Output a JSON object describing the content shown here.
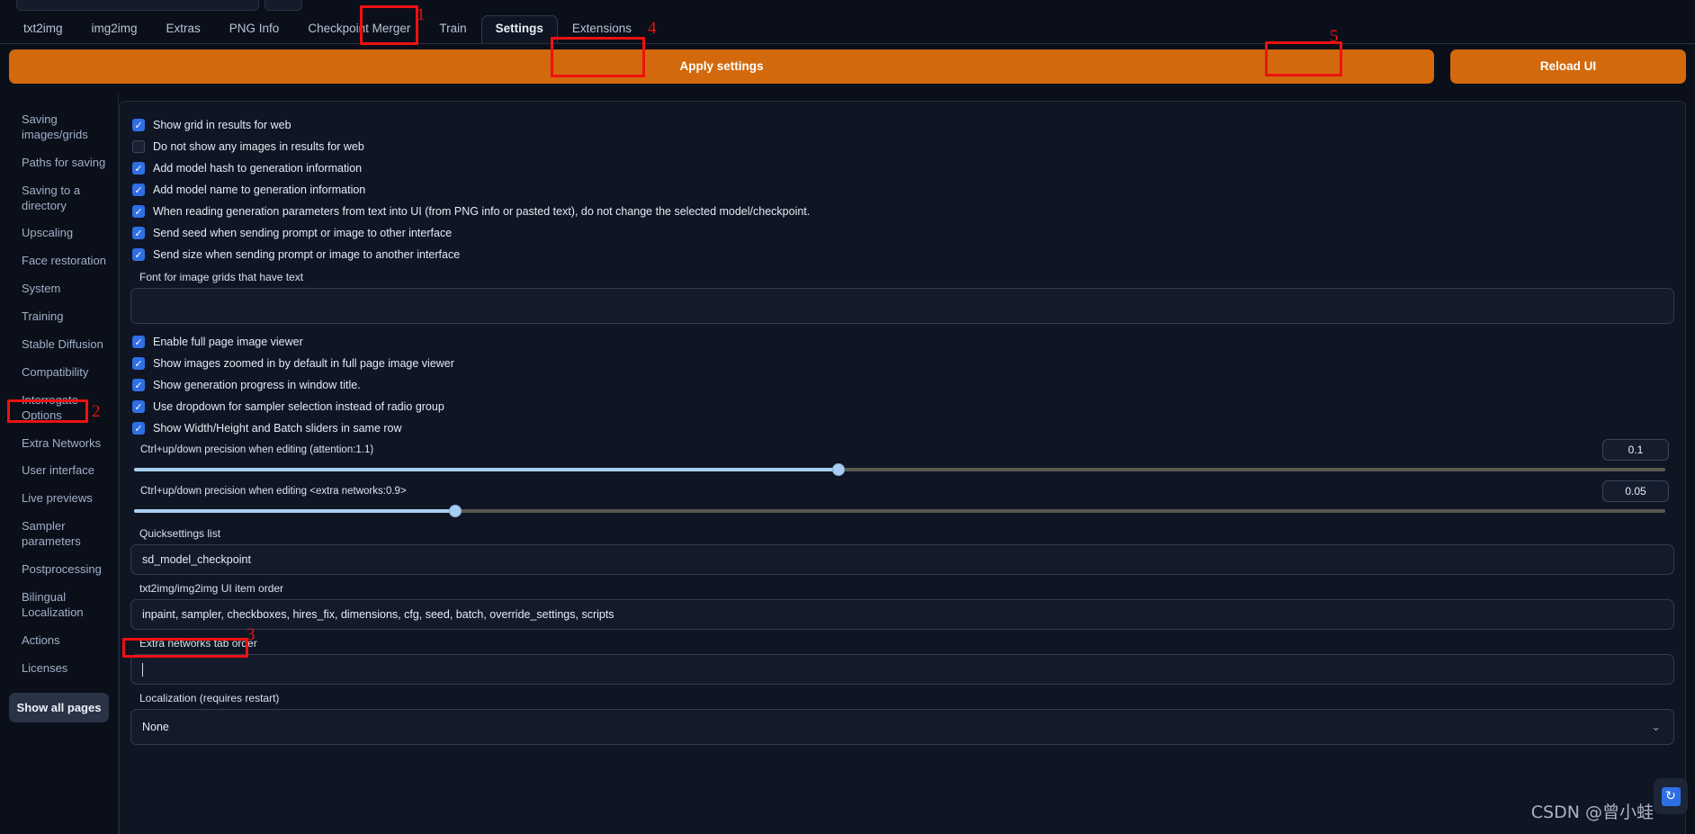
{
  "tabs": [
    {
      "label": "txt2img",
      "active": false
    },
    {
      "label": "img2img",
      "active": false
    },
    {
      "label": "Extras",
      "active": false
    },
    {
      "label": "PNG Info",
      "active": false
    },
    {
      "label": "Checkpoint Merger",
      "active": false
    },
    {
      "label": "Train",
      "active": false
    },
    {
      "label": "Settings",
      "active": true
    },
    {
      "label": "Extensions",
      "active": false
    }
  ],
  "buttons": {
    "apply": "Apply settings",
    "reload": "Reload UI"
  },
  "sidebar": {
    "items": [
      {
        "label": "Saving images/grids",
        "selected": false
      },
      {
        "label": "Paths for saving",
        "selected": false
      },
      {
        "label": "Saving to a directory",
        "selected": false
      },
      {
        "label": "Upscaling",
        "selected": false
      },
      {
        "label": "Face restoration",
        "selected": false
      },
      {
        "label": "System",
        "selected": false
      },
      {
        "label": "Training",
        "selected": false
      },
      {
        "label": "Stable Diffusion",
        "selected": false
      },
      {
        "label": "Compatibility",
        "selected": false
      },
      {
        "label": "Interrogate Options",
        "selected": false
      },
      {
        "label": "Extra Networks",
        "selected": false
      },
      {
        "label": "User interface",
        "selected": true
      },
      {
        "label": "Live previews",
        "selected": false
      },
      {
        "label": "Sampler parameters",
        "selected": false
      },
      {
        "label": "Postprocessing",
        "selected": false
      },
      {
        "label": "Bilingual Localization",
        "selected": false
      },
      {
        "label": "Actions",
        "selected": false
      },
      {
        "label": "Licenses",
        "selected": false
      }
    ],
    "show_all_pages": "Show all pages"
  },
  "settings": {
    "checkboxes": [
      {
        "label": "Show grid in results for web",
        "checked": true
      },
      {
        "label": "Do not show any images in results for web",
        "checked": false
      },
      {
        "label": "Add model hash to generation information",
        "checked": true
      },
      {
        "label": "Add model name to generation information",
        "checked": true
      },
      {
        "label": "When reading generation parameters from text into UI (from PNG info or pasted text), do not change the selected model/checkpoint.",
        "checked": true
      },
      {
        "label": "Send seed when sending prompt or image to other interface",
        "checked": true
      },
      {
        "label": "Send size when sending prompt or image to another interface",
        "checked": true
      }
    ],
    "font_field": {
      "label": "Font for image grids that have text",
      "value": ""
    },
    "checkboxes2": [
      {
        "label": "Enable full page image viewer",
        "checked": true
      },
      {
        "label": "Show images zoomed in by default in full page image viewer",
        "checked": true
      },
      {
        "label": "Show generation progress in window title.",
        "checked": true
      },
      {
        "label": "Use dropdown for sampler selection instead of radio group",
        "checked": true
      },
      {
        "label": "Show Width/Height and Batch sliders in same row",
        "checked": true
      }
    ],
    "sliders": [
      {
        "label": "Ctrl+up/down precision when editing (attention:1.1)",
        "value": "0.1",
        "percent": 46
      },
      {
        "label": "Ctrl+up/down precision when editing <extra networks:0.9>",
        "value": "0.05",
        "percent": 21
      }
    ],
    "text_fields": [
      {
        "label": "Quicksettings list",
        "value": "sd_model_checkpoint"
      },
      {
        "label": "txt2img/img2img UI item order",
        "value": "inpaint, sampler, checkboxes, hires_fix, dimensions, cfg, seed, batch, override_settings, scripts"
      },
      {
        "label": "Extra networks tab order",
        "value": ""
      }
    ],
    "localization": {
      "label": "Localization (requires restart)",
      "value": "None"
    }
  },
  "annotations": [
    {
      "number": "1",
      "target": "settings-tab"
    },
    {
      "number": "2",
      "target": "user-interface-sidebar-item"
    },
    {
      "number": "3",
      "target": "localization-label"
    },
    {
      "number": "4",
      "target": "apply-settings-button"
    },
    {
      "number": "5",
      "target": "reload-ui-button"
    }
  ],
  "watermark": "CSDN @曾小蛙",
  "colors": {
    "accent_orange": "#d2690d",
    "checkbox_blue": "#2f6fe4",
    "annotation_red": "#ee1111",
    "background": "#0b0f19",
    "panel": "#0f1522"
  }
}
